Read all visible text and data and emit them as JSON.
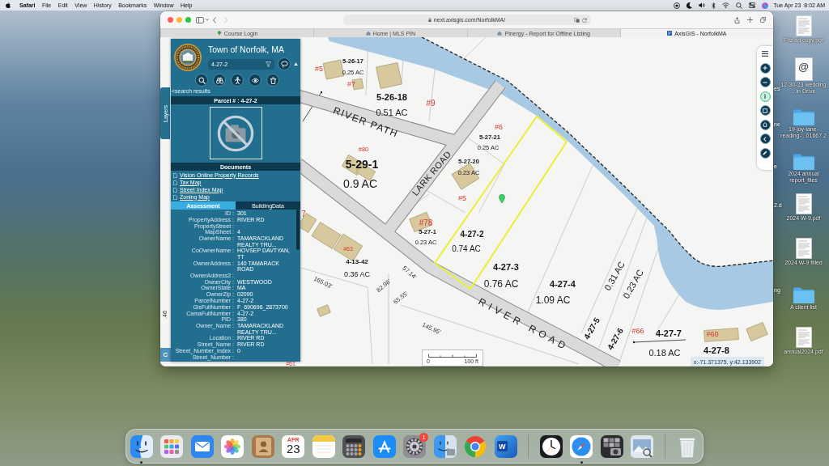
{
  "menu_bar": {
    "app_name": "Safari",
    "menus": [
      "File",
      "Edit",
      "View",
      "History",
      "Bookmarks",
      "Window",
      "Help"
    ],
    "date": "Tue Apr 23",
    "time": "8:02 AM"
  },
  "browser": {
    "back": {
      "disabled": false
    },
    "forward": {
      "disabled": true
    },
    "address": "next.axisgis.com/NorfolkMA/",
    "tabs": [
      {
        "label": "Course Login",
        "selected": false
      },
      {
        "label": "Home | MLS PIN",
        "selected": false
      },
      {
        "label": "Pinergy - Report for Offline Listing",
        "selected": false
      },
      {
        "label": "AxisGIS - NorfolkMA",
        "selected": true
      }
    ]
  },
  "panel": {
    "title": "Town of Norfolk, MA",
    "search": {
      "value": "4-27-2"
    },
    "back_link": "<search results",
    "parcel_header": "Parcel # : 4-27-2",
    "documents_header": "Documents",
    "documents": [
      "Vision Online Property Records",
      "Tax Map",
      "Street Index Map",
      "Zoning Map"
    ],
    "tabs": [
      {
        "label": "Assessment",
        "selected": true
      },
      {
        "label": "BuildingData",
        "selected": false
      }
    ],
    "fields": [
      {
        "label": "ID :",
        "value": "301"
      },
      {
        "label": "PropertyAddress :",
        "value": "RIVER RD"
      },
      {
        "label": "PropertyStreet :"
      },
      {
        "label": "MapSheet :",
        "value": "4"
      },
      {
        "label": "OwnerName :",
        "value": "TAMARACKLAND REALTY TRU..."
      },
      {
        "label": "CoOwnerName :",
        "value": "HOVSEP DAVTYAN, TT"
      },
      {
        "label": "OwnerAddress :",
        "value": "140 TAMARACK ROAD"
      },
      {
        "label": "OwnerAddress2 :"
      },
      {
        "label": "OwnerCity :",
        "value": "WESTWOOD"
      },
      {
        "label": "OwnerState :",
        "value": "MA"
      },
      {
        "label": "OwnerZip :",
        "value": "02090"
      },
      {
        "label": "ParcelNumber :",
        "value": "4-27-2"
      },
      {
        "label": "GisFullNumber :",
        "value": "F_690696_2873700"
      },
      {
        "label": "CamaFullNumber :",
        "value": "4-27-2"
      },
      {
        "label": "PID :",
        "value": "380"
      },
      {
        "label": "Owner_Name :",
        "value": "TAMARACKLAND REALTY TRU..."
      },
      {
        "label": "Location :",
        "value": "RIVER RD"
      },
      {
        "label": "Street_Name :",
        "value": "RIVER RD"
      },
      {
        "label": "Street_Number_Index :",
        "value": "0"
      },
      {
        "label": "Street_Number :"
      }
    ]
  },
  "map": {
    "layers_tab": "Layers",
    "corner_tab": "C",
    "labels": [
      {
        "text": "#5",
        "kind": "address"
      },
      {
        "text": "5-26-17",
        "kind": "parcel_id"
      },
      {
        "text": "0.25 AC",
        "kind": "area"
      },
      {
        "text": "#7",
        "kind": "address"
      },
      {
        "text": "5-26-18",
        "kind": "parcel_id"
      },
      {
        "text": "0.51 AC",
        "kind": "area"
      },
      {
        "text": "#9",
        "kind": "address"
      },
      {
        "text": "RIVER PATH",
        "kind": "street"
      },
      {
        "text": "#6",
        "kind": "address"
      },
      {
        "text": "5-27-21",
        "kind": "parcel_id"
      },
      {
        "text": "0.25 AC",
        "kind": "area"
      },
      {
        "text": "LARK ROAD",
        "kind": "street"
      },
      {
        "text": "#80",
        "kind": "address"
      },
      {
        "text": "5-29-1",
        "kind": "parcel_id"
      },
      {
        "text": "0.9 AC",
        "kind": "area"
      },
      {
        "text": "5-27-20",
        "kind": "parcel_id"
      },
      {
        "text": "0.23 AC",
        "kind": "area"
      },
      {
        "text": "#5",
        "kind": "address"
      },
      {
        "text": "#78",
        "kind": "address"
      },
      {
        "text": "5-27-1",
        "kind": "parcel_id"
      },
      {
        "text": "0.23 AC",
        "kind": "area"
      },
      {
        "text": "4-27-2",
        "kind": "parcel_id"
      },
      {
        "text": "0.74 AC",
        "kind": "area"
      },
      {
        "text": "#63",
        "kind": "address"
      },
      {
        "text": "4-13-42",
        "kind": "parcel_id"
      },
      {
        "text": "0.36 AC",
        "kind": "area"
      },
      {
        "text": "165.03'",
        "kind": "dimension"
      },
      {
        "text": "82.98'",
        "kind": "dimension"
      },
      {
        "text": "57.14'",
        "kind": "dimension"
      },
      {
        "text": "65.55'",
        "kind": "dimension"
      },
      {
        "text": "4-27-3",
        "kind": "parcel_id"
      },
      {
        "text": "0.76 AC",
        "kind": "area"
      },
      {
        "text": "4-27-4",
        "kind": "parcel_id"
      },
      {
        "text": "1.09 AC",
        "kind": "area"
      },
      {
        "text": "0.31 AC",
        "kind": "area"
      },
      {
        "text": "0.23 AC",
        "kind": "area"
      },
      {
        "text": "RIVER ROAD",
        "kind": "street"
      },
      {
        "text": "145.95'",
        "kind": "dimension"
      },
      {
        "text": "4-27-5",
        "kind": "parcel_id"
      },
      {
        "text": "4-27-6",
        "kind": "parcel_id"
      },
      {
        "text": "#66",
        "kind": "address"
      },
      {
        "text": "4-27-7",
        "kind": "parcel_id"
      },
      {
        "text": "0.18 AC",
        "kind": "area"
      },
      {
        "text": "#60",
        "kind": "address"
      },
      {
        "text": "4-27-8",
        "kind": "parcel_id"
      },
      {
        "text": "7",
        "kind": "address"
      },
      {
        "text": "#61",
        "kind": "address"
      },
      {
        "text": ".46",
        "kind": "dimension"
      }
    ],
    "scale": {
      "start": "0",
      "end": "100 ft"
    },
    "coordinates": "x:-71.371375, y:42.133902",
    "tools": [
      {
        "selected": false
      },
      {
        "selected": false
      },
      {
        "selected": true
      },
      {
        "selected": false
      },
      {
        "selected": false
      },
      {
        "selected": false
      },
      {
        "selected": false
      }
    ]
  },
  "desktop": {
    "files": [
      {
        "kind": "pdf",
        "name": "Fitz ad copy.pdf"
      },
      {
        "kind": "email",
        "glyph": "@",
        "name": "12-30-23 wedding ...in Drive"
      },
      {
        "kind": "folder",
        "name": "19-joy-lane-reading-...01667 2"
      },
      {
        "kind": "folder",
        "name": "2024 annual report_files"
      },
      {
        "kind": "pdf",
        "name": "2024 W-9.pdf"
      },
      {
        "kind": "pdf",
        "name": "2024 W-9 filled"
      },
      {
        "kind": "folder",
        "name": "A client list"
      },
      {
        "kind": "pdf",
        "name": "annual2024.pdf"
      }
    ],
    "hidden_labels": [
      "es",
      "ne",
      "e",
      "2.d",
      "ng"
    ]
  },
  "dock": {
    "items": [
      {
        "kind": "finder",
        "running": true
      },
      {
        "kind": "launchpad",
        "running": false
      },
      {
        "kind": "mail",
        "running": false
      },
      {
        "kind": "photos",
        "running": false
      },
      {
        "kind": "contacts",
        "running": false
      },
      {
        "kind": "calendar",
        "running": false,
        "month": "APR",
        "day": "23"
      },
      {
        "kind": "notes",
        "running": false
      },
      {
        "kind": "calculator",
        "running": false
      },
      {
        "kind": "appstore",
        "running": false
      },
      {
        "kind": "settings",
        "running": false,
        "badge": "1"
      },
      {
        "kind": "migration",
        "running": false
      },
      {
        "kind": "chrome",
        "running": false
      },
      {
        "kind": "word",
        "running": false,
        "letter": "W"
      },
      {
        "kind": "separator"
      },
      {
        "kind": "clock",
        "running": false
      },
      {
        "kind": "safari",
        "running": true
      },
      {
        "kind": "photobooth",
        "running": false
      },
      {
        "kind": "preview",
        "running": false
      },
      {
        "kind": "separator"
      },
      {
        "kind": "trash",
        "running": false
      }
    ]
  }
}
